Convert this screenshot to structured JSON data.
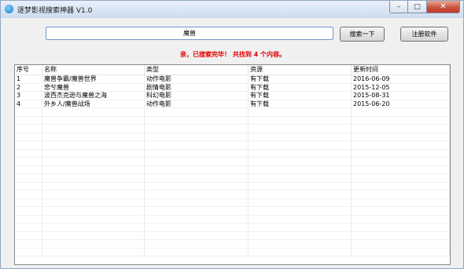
{
  "window": {
    "title": "逐梦影视搜索神器 V1.0"
  },
  "search": {
    "query": "魔兽",
    "button_label": "搜索一下"
  },
  "register_label": "注册软件",
  "status_message": "亲，已搜索完毕！ 共找到 4 个内容。",
  "colors": {
    "status": "#e20000",
    "title_bar": "#dbe6f4",
    "close_button": "#c9503a"
  },
  "table": {
    "headers": [
      "序号",
      "名称",
      "类型",
      "资源",
      "更新时间"
    ],
    "rows": [
      [
        "1",
        "魔兽争霸/魔兽世界",
        "动作电影",
        "有下载",
        "2016-06-09"
      ],
      [
        "2",
        "悲兮魔兽",
        "剧情电影",
        "有下载",
        "2015-12-05"
      ],
      [
        "3",
        "波西杰克逊与魔兽之海",
        "科幻电影",
        "有下载",
        "2015-08-31"
      ],
      [
        "4",
        "外乡人/魔兽战场",
        "动作电影",
        "有下载",
        "2015-06-20"
      ]
    ]
  }
}
